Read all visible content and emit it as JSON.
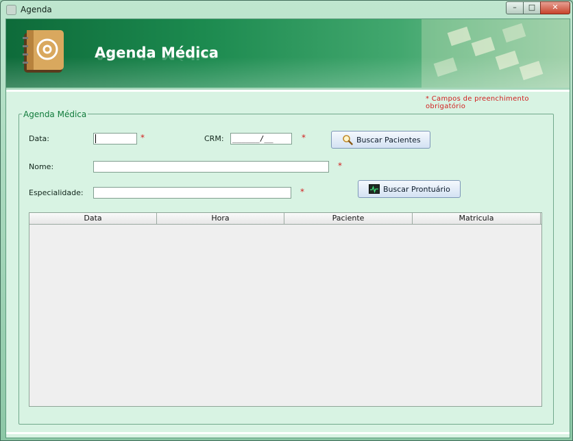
{
  "window": {
    "title": "Agenda"
  },
  "window_controls": {
    "minimize": "–",
    "maximize": "□",
    "close": "✕"
  },
  "banner": {
    "title": "Agenda Médica"
  },
  "form": {
    "required_note": "* Campos de preenchimento obrigatório",
    "legend": "Agenda Médica",
    "required_mark": "*",
    "data_label": "Data:",
    "data_value": "",
    "crm_label": "CRM:",
    "crm_value": "______/__",
    "nome_label": "Nome:",
    "nome_value": "",
    "especialidade_label": "Especialidade:",
    "especialidade_value": "",
    "buscar_pacientes_label": "Buscar Pacientes",
    "buscar_prontuario_label": "Buscar Prontuário"
  },
  "table": {
    "columns": [
      "Data",
      "Hora",
      "Paciente",
      "Matricula"
    ],
    "rows": []
  },
  "icons": {
    "app": "app-icon",
    "banner": "address-book-icon",
    "buscar_pacientes": "magnifier-icon",
    "buscar_prontuario": "heart-monitor-icon"
  },
  "colors": {
    "banner_green": "#1c8a4f",
    "required_red": "#d11d1d",
    "legend_green": "#0f7a3a"
  }
}
